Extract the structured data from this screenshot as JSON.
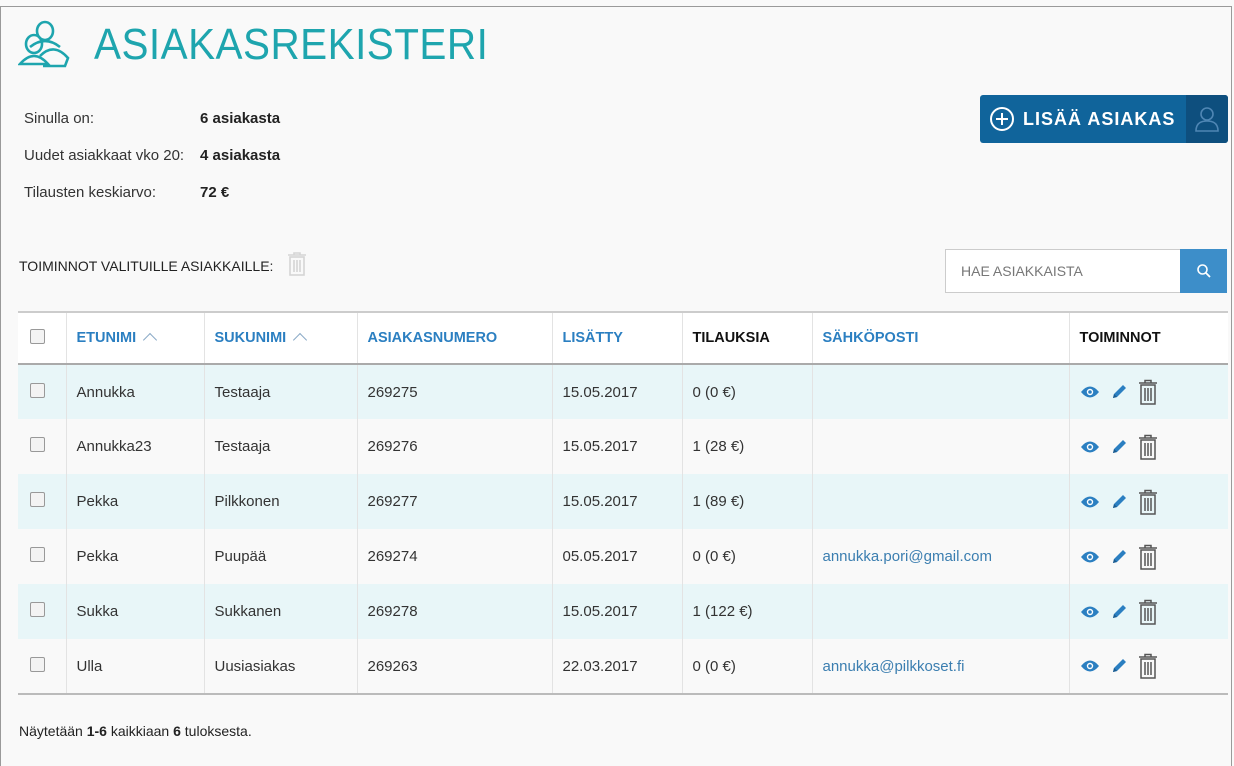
{
  "header": {
    "title": "ASIAKASREKISTERI"
  },
  "stats": [
    {
      "label": "Sinulla on:",
      "value": "6 asiakasta"
    },
    {
      "label": "Uudet asiakkaat vko 20:",
      "value": "4 asiakasta"
    },
    {
      "label": "Tilausten keskiarvo:",
      "value": "72 €"
    }
  ],
  "add_button": {
    "label": "LISÄÄ ASIAKAS"
  },
  "bulk": {
    "label": "TOIMINNOT VALITUILLE ASIAKKAILLE:"
  },
  "search": {
    "placeholder": "HAE ASIAKKAISTA"
  },
  "table": {
    "headers": [
      "ETUNIMI",
      "SUKUNIMI",
      "ASIAKASNUMERO",
      "LISÄTTY",
      "TILAUKSIA",
      "SÄHKÖPOSTI",
      "TOIMINNOT"
    ],
    "rows": [
      {
        "first": "Annukka",
        "last": "Testaaja",
        "number": "269275",
        "added": "15.05.2017",
        "orders": "0 (0 €)",
        "email": ""
      },
      {
        "first": "Annukka23",
        "last": "Testaaja",
        "number": "269276",
        "added": "15.05.2017",
        "orders": "1 (28 €)",
        "email": ""
      },
      {
        "first": "Pekka",
        "last": "Pilkkonen",
        "number": "269277",
        "added": "15.05.2017",
        "orders": "1 (89 €)",
        "email": ""
      },
      {
        "first": "Pekka",
        "last": "Puupää",
        "number": "269274",
        "added": "05.05.2017",
        "orders": "0 (0 €)",
        "email": "annukka.pori@gmail.com"
      },
      {
        "first": "Sukka",
        "last": "Sukkanen",
        "number": "269278",
        "added": "15.05.2017",
        "orders": "1 (122 €)",
        "email": ""
      },
      {
        "first": "Ulla",
        "last": "Uusiasiakas",
        "number": "269263",
        "added": "22.03.2017",
        "orders": "0 (0 €)",
        "email": "annukka@pilkkoset.fi"
      }
    ]
  },
  "footer": {
    "prefix": "Näytetään",
    "range": "1-6",
    "middle": "kaikkiaan",
    "total": "6",
    "suffix": "tuloksesta."
  },
  "colors": {
    "accent": "#1ea5ae",
    "button": "#10649b",
    "link": "#2b7fc1",
    "row_alt": "#e8f6f8"
  }
}
